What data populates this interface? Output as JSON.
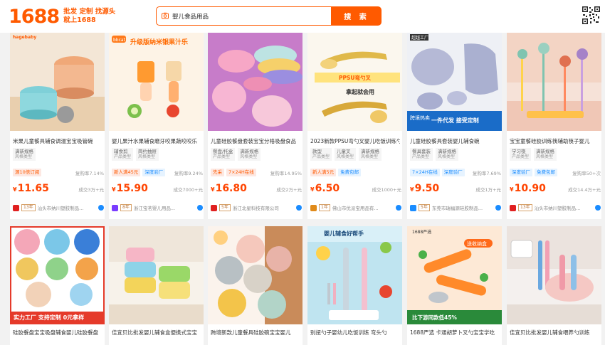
{
  "header": {
    "logo_number": "1688",
    "slogan_line1": "批发 定制 找源头",
    "slogan_line2": "就上1688",
    "search_value": "婴儿食品用品",
    "search_button": "搜 索"
  },
  "row1": [
    {
      "title": "米果儿童餐具辅食调温宝宝吸管碗",
      "tags": [
        {
          "name": "满新规格",
          "sub": "风格类型"
        }
      ],
      "badges": [
        {
          "text": "源10倍订阅",
          "style": "red"
        }
      ],
      "rate": "复购率7.14%",
      "price": "11.65",
      "sold": "成交3万+元",
      "year": "13年",
      "shop": "汕头市纳川塑胶制品..."
    },
    {
      "title": "婴儿果汁水果辅食磨牙咬果蔬咬咬乐",
      "tags": [
        {
          "name": "辅食剪",
          "sub": "产品类型"
        },
        {
          "name": "简约抽屉",
          "sub": "风格类型"
        }
      ],
      "badges": [
        {
          "text": "新人满45元",
          "style": "red"
        },
        {
          "text": "深度验厂",
          "style": "blue"
        }
      ],
      "rate": "复购率9.24%",
      "price": "15.90",
      "sold": "成交7000+元",
      "year": "8年",
      "shop": "浙江宝茗婴儿用品..."
    },
    {
      "title": "儿童硅胶餐盘套装宝宝分格吸盘食品",
      "tags": [
        {
          "name": "餐盘/托盒",
          "sub": "产品类型"
        },
        {
          "name": "满新规格",
          "sub": "风格类型"
        }
      ],
      "badges": [
        {
          "text": "先采",
          "style": "red"
        },
        {
          "text": "7×24H在线",
          "style": "red"
        }
      ],
      "rate": "复购率14.95%",
      "price": "16.80",
      "sold": "成交2万+元",
      "year": "5年",
      "shop": "浙江北星科技有限公司"
    },
    {
      "title": "2023新款PPSU弯勺叉婴儿吃饭训练勺",
      "tags": [
        {
          "name": "款型",
          "sub": "产品类型"
        },
        {
          "name": "儿童叉",
          "sub": "风格类型"
        },
        {
          "name": "满新规格",
          "sub": "风格类型"
        }
      ],
      "badges": [
        {
          "text": "新人满5元",
          "style": "red"
        },
        {
          "text": "免费包邮",
          "style": "blue"
        }
      ],
      "rate": "",
      "price": "6.50",
      "sold": "成交1000+元",
      "year": "1年",
      "shop": "佛山市优派宝用品有..."
    },
    {
      "title": "儿童硅胶餐具套装婴儿辅食碗",
      "tags": [
        {
          "name": "餐具套装",
          "sub": "产品类型"
        },
        {
          "name": "满新规格",
          "sub": "风格类型"
        }
      ],
      "badges": [
        {
          "text": "7×24H在线",
          "style": "blue"
        },
        {
          "text": "深度验厂",
          "style": "blue"
        }
      ],
      "rate": "复购率7.69%",
      "price": "9.50",
      "sold": "成交1万+元",
      "year": "5年",
      "shop": "东莞市瑞福源硅胶制品..."
    },
    {
      "title": "宝宝童餐硅胶训练筷辅助筷子婴儿",
      "tags": [
        {
          "name": "学习筷",
          "sub": "产品类型"
        },
        {
          "name": "满新规格",
          "sub": "风格类型"
        }
      ],
      "badges": [
        {
          "text": "深度验厂",
          "style": "blue"
        },
        {
          "text": "免费包邮",
          "style": "blue"
        }
      ],
      "rate": "复购率50+次",
      "price": "10.90",
      "sold": "成交14.4万+元",
      "year": "13年",
      "shop": "汕头市纳川塑胶制品..."
    }
  ],
  "row2": [
    {
      "title": "硅胶餐盘宝宝吸盘辅食婴儿硅胶餐盘",
      "overlay": "实力工厂 支持定制 0元拿样"
    },
    {
      "title": "佳宜贝比批发婴儿辅食盒便携式宝宝",
      "overlay": ""
    },
    {
      "title": "跨境新款儿童餐具硅胶碗宝宝婴儿",
      "overlay": ""
    },
    {
      "title": "别扭勺子婴幼儿吃饭训练 弯头勺",
      "overlay": "婴儿辅食好帮手"
    },
    {
      "title": "1688严选 卡通胡萝卜叉勺宝宝学吃",
      "overlay": "比下游同款低45%"
    },
    {
      "title": "佳宜贝比批发婴儿辅食喂养勺训练",
      "overlay": ""
    }
  ],
  "colors": {
    "accent": "#ff5a00",
    "price": "#ff4400"
  }
}
